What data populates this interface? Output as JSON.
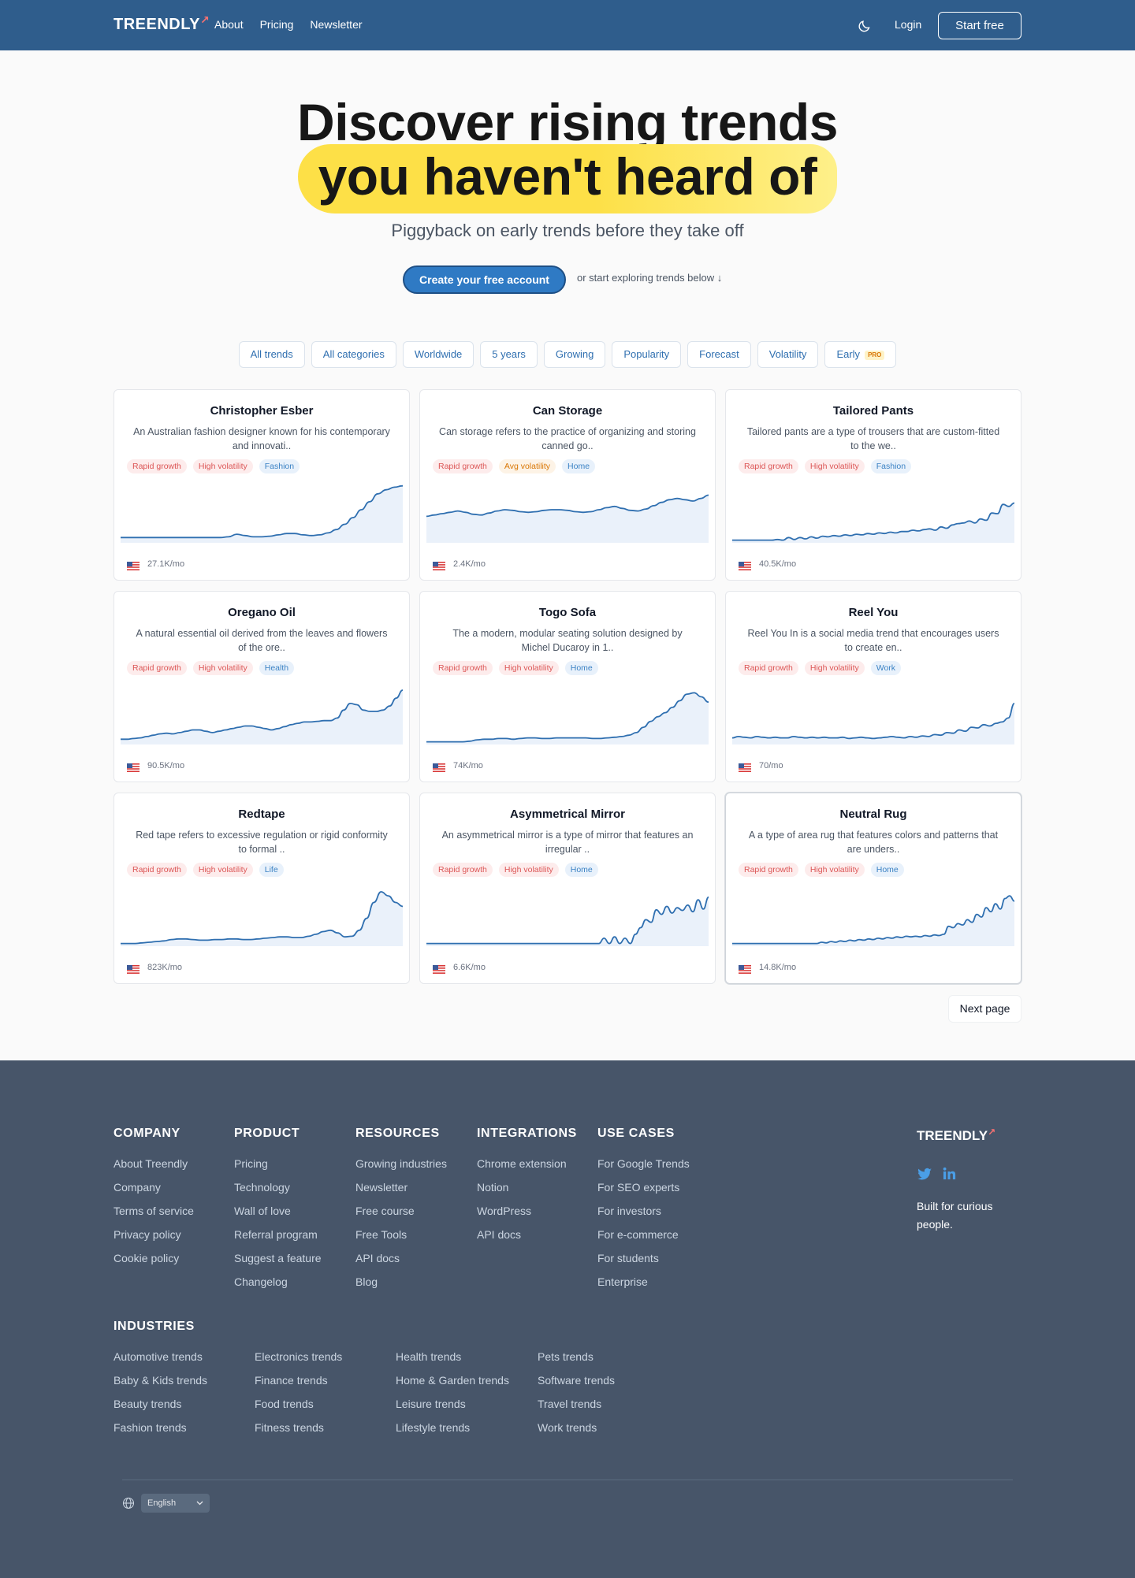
{
  "nav": {
    "logo": "TREENDLY",
    "links": [
      "About",
      "Pricing",
      "Newsletter"
    ],
    "login": "Login",
    "start_free": "Start free"
  },
  "hero": {
    "title_line1": "Discover rising trends",
    "title_line2": "you haven't heard of",
    "subtitle": "Piggyback on early trends before they take off",
    "cta": "Create your free account",
    "cta_note": "or start exploring trends below ↓"
  },
  "filters": [
    "All trends",
    "All categories",
    "Worldwide",
    "5 years",
    "Growing",
    "Popularity",
    "Forecast",
    "Volatility",
    "Early"
  ],
  "filter_badge": "PRO",
  "cards": [
    {
      "title": "Christopher Esber",
      "desc": "An Australian fashion designer known for his contemporary and innovati..",
      "tags": [
        "Rapid growth",
        "High volatility",
        "Fashion"
      ],
      "volume": "27.1K/mo",
      "trend": [
        8,
        8,
        8,
        8,
        8,
        8,
        8,
        8,
        8,
        8,
        8,
        8,
        8,
        9,
        13,
        11,
        9,
        9,
        10,
        12,
        14,
        14,
        12,
        11,
        12,
        15,
        20,
        28,
        38,
        50,
        62,
        74,
        80,
        84,
        86
      ]
    },
    {
      "title": "Can Storage",
      "desc": "Can storage refers to the practice of organizing and storing canned go..",
      "tags": [
        "Rapid growth",
        "Avg volatility",
        "Home"
      ],
      "volume": "2.4K/mo",
      "trend": [
        40,
        42,
        44,
        46,
        48,
        46,
        43,
        42,
        45,
        48,
        50,
        49,
        47,
        46,
        47,
        49,
        50,
        50,
        49,
        47,
        46,
        47,
        50,
        53,
        55,
        52,
        49,
        48,
        51,
        56,
        61,
        65,
        67,
        65,
        63,
        67,
        72
      ]
    },
    {
      "title": "Tailored Pants",
      "desc": "Tailored pants are a type of trousers that are custom-fitted to the we..",
      "tags": [
        "Rapid growth",
        "High volatility",
        "Fashion"
      ],
      "volume": "40.5K/mo",
      "trend": [
        4,
        4,
        4,
        4,
        4,
        4,
        4,
        4,
        5,
        4,
        8,
        5,
        8,
        6,
        9,
        7,
        10,
        9,
        11,
        10,
        12,
        11,
        13,
        12,
        14,
        13,
        15,
        14,
        16,
        15,
        17,
        17,
        19,
        18,
        20,
        21,
        19,
        24,
        22,
        27,
        29,
        30,
        33,
        30,
        36,
        34,
        45,
        44,
        58,
        55,
        60
      ]
    },
    {
      "title": "Oregano Oil",
      "desc": "A natural essential oil derived from the leaves and flowers of the ore..",
      "tags": [
        "Rapid growth",
        "High volatility",
        "Health"
      ],
      "volume": "90.5K/mo",
      "trend": [
        8,
        8,
        9,
        10,
        12,
        14,
        16,
        17,
        16,
        18,
        20,
        22,
        22,
        20,
        18,
        20,
        22,
        24,
        26,
        28,
        28,
        26,
        24,
        22,
        24,
        27,
        30,
        32,
        34,
        34,
        35,
        36,
        36,
        40,
        52,
        62,
        60,
        52,
        50,
        50,
        52,
        58,
        70,
        82
      ]
    },
    {
      "title": "Togo Sofa",
      "desc": "The a modern, modular seating solution designed by Michel Ducaroy in 1..",
      "tags": [
        "Rapid growth",
        "High volatility",
        "Home"
      ],
      "volume": "74K/mo",
      "trend": [
        4,
        4,
        4,
        4,
        4,
        4,
        5,
        7,
        8,
        8,
        9,
        9,
        8,
        9,
        10,
        10,
        9,
        9,
        10,
        10,
        10,
        10,
        10,
        9,
        9,
        10,
        11,
        12,
        14,
        18,
        26,
        35,
        42,
        48,
        56,
        66,
        76,
        78,
        72,
        64
      ]
    },
    {
      "title": "Reel You",
      "desc": "Reel You In is a social media trend that encourages users to create en..",
      "tags": [
        "Rapid growth",
        "High volatility",
        "Work"
      ],
      "volume": "70/mo",
      "trend": [
        10,
        12,
        11,
        10,
        12,
        11,
        10,
        11,
        10,
        10,
        12,
        11,
        10,
        11,
        10,
        11,
        10,
        10,
        11,
        9,
        10,
        11,
        10,
        9,
        10,
        11,
        12,
        11,
        10,
        12,
        11,
        13,
        12,
        15,
        14,
        18,
        17,
        22,
        20,
        26,
        25,
        30,
        28,
        32,
        34,
        40,
        62
      ]
    },
    {
      "title": "Redtape",
      "desc": "Red tape refers to excessive regulation or rigid conformity to formal ..",
      "tags": [
        "Rapid growth",
        "High volatility",
        "Life"
      ],
      "volume": "823K/mo",
      "trend": [
        4,
        4,
        4,
        5,
        6,
        7,
        8,
        10,
        11,
        11,
        10,
        9,
        9,
        10,
        10,
        11,
        11,
        10,
        10,
        11,
        12,
        13,
        14,
        14,
        13,
        13,
        15,
        18,
        22,
        24,
        20,
        14,
        15,
        24,
        42,
        66,
        82,
        76,
        66,
        60
      ]
    },
    {
      "title": "Asymmetrical Mirror",
      "desc": "An asymmetrical mirror is a type of mirror that features an irregular ..",
      "tags": [
        "Rapid growth",
        "High volatility",
        "Home"
      ],
      "volume": "6.6K/mo",
      "trend": [
        4,
        4,
        4,
        4,
        4,
        4,
        4,
        4,
        4,
        4,
        4,
        4,
        4,
        4,
        4,
        4,
        4,
        4,
        4,
        4,
        4,
        4,
        4,
        4,
        4,
        4,
        4,
        4,
        4,
        4,
        4,
        4,
        4,
        4,
        12,
        4,
        14,
        4,
        12,
        4,
        18,
        28,
        40,
        36,
        55,
        48,
        60,
        50,
        58,
        54,
        62,
        52,
        70,
        56,
        74
      ]
    },
    {
      "title": "Neutral Rug",
      "desc": "A a type of area rug that features colors and patterns that are unders..",
      "tags": [
        "Rapid growth",
        "High volatility",
        "Home"
      ],
      "volume": "14.8K/mo",
      "trend": [
        4,
        4,
        4,
        4,
        4,
        4,
        4,
        4,
        4,
        4,
        4,
        4,
        4,
        4,
        4,
        4,
        4,
        4,
        4,
        6,
        5,
        7,
        6,
        8,
        7,
        9,
        8,
        10,
        9,
        11,
        10,
        12,
        11,
        13,
        12,
        14,
        13,
        15,
        14,
        15,
        14,
        16,
        15,
        17,
        16,
        18,
        30,
        28,
        34,
        32,
        40,
        36,
        48,
        44,
        58,
        52,
        64,
        56,
        72,
        76,
        68
      ]
    }
  ],
  "next_page": "Next page",
  "footer": {
    "columns": [
      {
        "head": "COMPANY",
        "items": [
          "About Treendly",
          "Company",
          "Terms of service",
          "Privacy policy",
          "Cookie policy"
        ]
      },
      {
        "head": "PRODUCT",
        "items": [
          "Pricing",
          "Technology",
          "Wall of love",
          "Referral program",
          "Suggest a feature",
          "Changelog"
        ]
      },
      {
        "head": "RESOURCES",
        "items": [
          "Growing industries",
          "Newsletter",
          "Free course",
          "Free Tools",
          "API docs",
          "Blog"
        ]
      },
      {
        "head": "INTEGRATIONS",
        "items": [
          "Chrome extension",
          "Notion",
          "WordPress",
          "API docs"
        ]
      },
      {
        "head": "USE CASES",
        "items": [
          "For Google Trends",
          "For SEO experts",
          "For investors",
          "For e-commerce",
          "For students",
          "Enterprise"
        ]
      }
    ],
    "industries_head": "INDUSTRIES",
    "industries": [
      [
        "Automotive trends",
        "Baby & Kids trends",
        "Beauty trends",
        "Fashion trends"
      ],
      [
        "Electronics trends",
        "Finance trends",
        "Food trends",
        "Fitness trends"
      ],
      [
        "Health trends",
        "Home & Garden trends",
        "Leisure trends",
        "Lifestyle trends"
      ],
      [
        "Pets trends",
        "Software trends",
        "Travel trends",
        "Work trends"
      ]
    ],
    "logo": "TREENDLY",
    "tagline": "Built for curious people.",
    "language": "English"
  },
  "colors": {
    "nav_bg": "#2f5d8c",
    "footer_bg": "#475569",
    "accent": "#2f7ac4",
    "highlight": "#fde047",
    "line": "#2f6fb0"
  },
  "icons": [
    "moon-icon",
    "us-flag-icon",
    "twitter-icon",
    "linkedin-icon",
    "globe-icon",
    "chevron-down-icon"
  ]
}
